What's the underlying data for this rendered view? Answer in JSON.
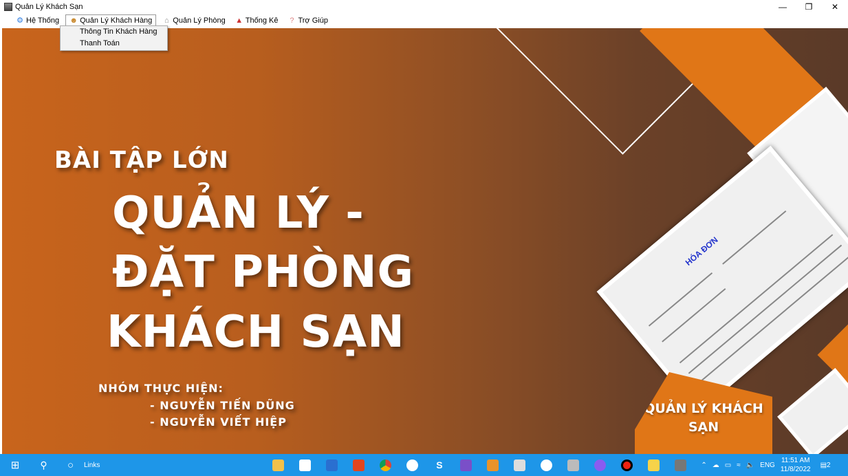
{
  "window": {
    "title": "Quản Lý Khách Sạn",
    "controls": [
      "minimize",
      "restore",
      "close"
    ]
  },
  "menu": {
    "items": [
      {
        "label": "Hệ Thống",
        "icon": "gear-icon"
      },
      {
        "label": "Quản Lý Khách Hàng",
        "icon": "users-icon"
      },
      {
        "label": "Quản Lý Phòng",
        "icon": "home-icon"
      },
      {
        "label": "Thống Kê",
        "icon": "chart-icon"
      },
      {
        "label": "Trợ Giúp",
        "icon": "help-icon"
      }
    ],
    "dropdown": [
      "Thông Tin Khách Hàng",
      "Thanh Toán"
    ]
  },
  "slide": {
    "subtitle": "BÀI TẬP LỚN",
    "line1": "QUẢN LÝ -",
    "line2": "ĐẶT PHÒNG",
    "line3": "KHÁCH SẠN",
    "team_label": "NHÓM THỰC HIỆN:",
    "members": [
      "- NGUYỄN TIẾN DŨNG",
      "- NGUYỄN VIẾT HIỆP"
    ],
    "form_title": "HÓA ĐƠN",
    "badge": "QUẢN LÝ KHÁCH SẠN"
  },
  "taskbar": {
    "search_text": "Links",
    "tray_lang": "ENG",
    "time": "11:51 AM",
    "date": "11/8/2022",
    "notifications": "2"
  },
  "colors": {
    "orange": "#e07617",
    "taskbar": "#1e96e8"
  }
}
